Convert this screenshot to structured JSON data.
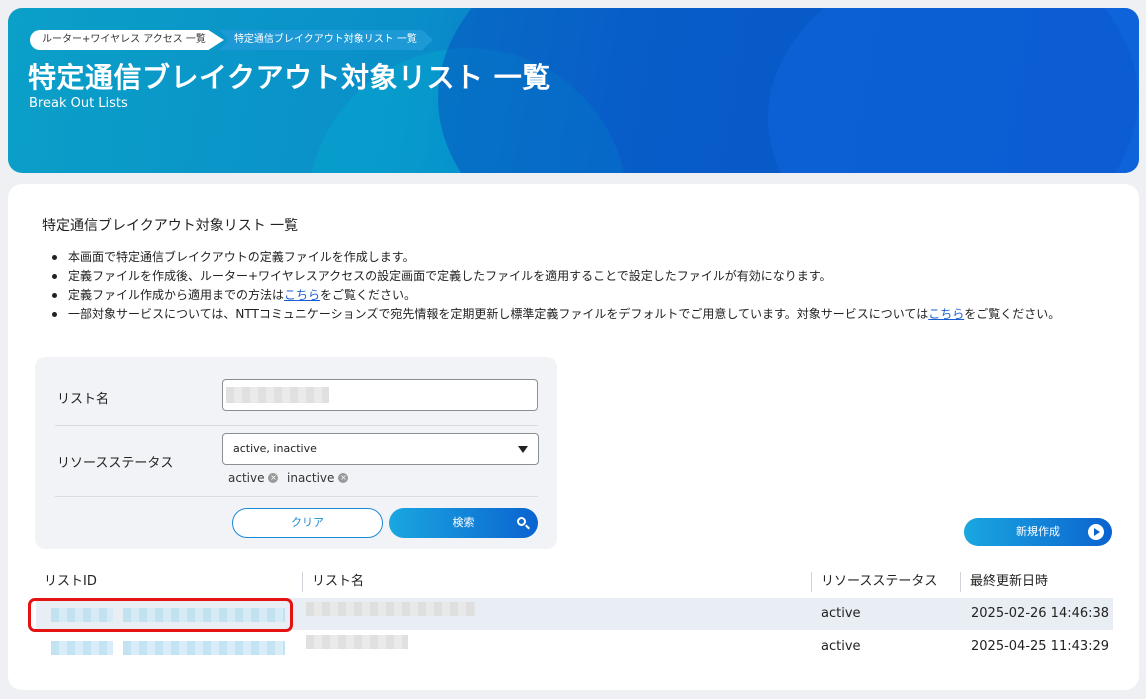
{
  "header": {
    "breadcrumb": [
      "ルーター+ワイヤレス アクセス 一覧",
      "特定通信ブレイクアウト対象リスト 一覧"
    ],
    "title": "特定通信ブレイクアウト対象リスト 一覧",
    "subtitle": "Break Out Lists"
  },
  "section": {
    "title": "特定通信ブレイクアウト対象リスト 一覧",
    "notes": [
      "本画面で特定通信ブレイクアウトの定義ファイルを作成します。",
      "定義ファイルを作成後、ルーター+ワイヤレスアクセスの設定画面で定義したファイルを適用することで設定したファイルが有効になります。"
    ],
    "note3_pre": "定義ファイル作成から適用までの方法は",
    "note3_link": "こちら",
    "note3_post": "をご覧ください。",
    "note4_pre": "一部対象サービスについては、NTTコミュニケーションズで宛先情報を定期更新し標準定義ファイルをデフォルトでご用意しています。対象サービスについては",
    "note4_link": "こちら",
    "note4_post": "をご覧ください。"
  },
  "search": {
    "list_name_label": "リスト名",
    "status_label": "リソースステータス",
    "status_value": "active, inactive",
    "chips": [
      "active",
      "inactive"
    ],
    "clear_label": "クリア",
    "search_label": "検索"
  },
  "new_button_label": "新規作成",
  "table": {
    "headers": [
      "リストID",
      "リスト名",
      "リソースステータス",
      "最終更新日時"
    ],
    "rows": [
      {
        "status": "active",
        "updated": "2025-02-26 14:46:38"
      },
      {
        "status": "active",
        "updated": "2025-04-25 11:43:29"
      }
    ]
  },
  "colors": {
    "accent": "#0b63d0",
    "highlight": "#e51212"
  }
}
